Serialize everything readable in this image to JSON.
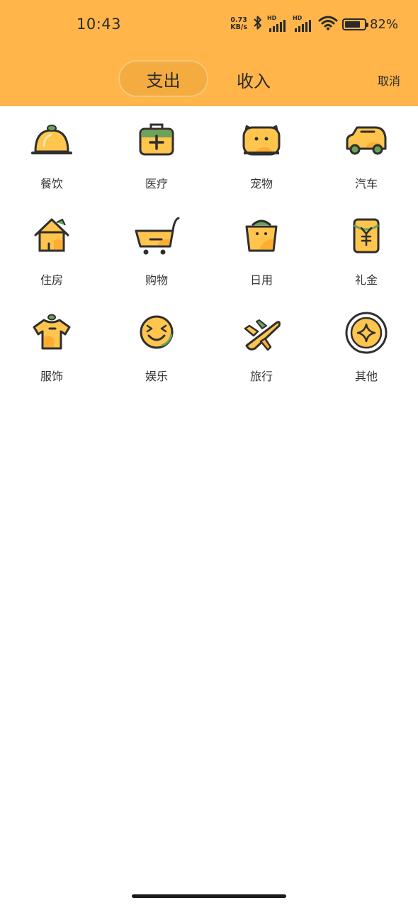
{
  "status_bar": {
    "time": "10:43",
    "net_speed_value": "0.73",
    "net_speed_unit": "KB/s",
    "sim1_label": "HD",
    "sim2_label": "HD",
    "battery_percent": "82%",
    "battery_level": 0.82
  },
  "header": {
    "tabs": [
      {
        "label": "支出",
        "selected": true
      },
      {
        "label": "收入",
        "selected": false
      }
    ],
    "cancel_label": "取消",
    "background_color": "#ffb54a",
    "selected_tab_color": "#f4ab40"
  },
  "categories": [
    {
      "label": "餐饮",
      "icon": "food-cloche-icon"
    },
    {
      "label": "医疗",
      "icon": "medical-kit-icon"
    },
    {
      "label": "宠物",
      "icon": "pet-icon"
    },
    {
      "label": "汽车",
      "icon": "car-icon"
    },
    {
      "label": "住房",
      "icon": "house-icon"
    },
    {
      "label": "购物",
      "icon": "shopping-cart-icon"
    },
    {
      "label": "日用",
      "icon": "daily-bag-icon"
    },
    {
      "label": "礼金",
      "icon": "gift-money-icon"
    },
    {
      "label": "服饰",
      "icon": "clothing-icon"
    },
    {
      "label": "娱乐",
      "icon": "entertainment-face-icon"
    },
    {
      "label": "旅行",
      "icon": "airplane-icon"
    },
    {
      "label": "其他",
      "icon": "other-star-icon"
    }
  ],
  "icon_colors": {
    "fill": "#ffc54d",
    "shade": "#ffad32",
    "outline": "#2f2f2f",
    "leaf": "#6ca35a"
  }
}
